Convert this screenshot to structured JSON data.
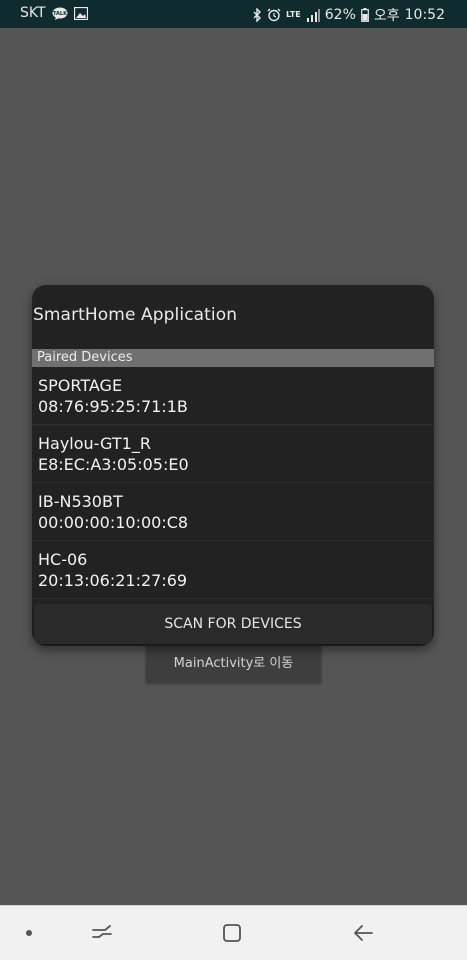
{
  "status_bar": {
    "carrier": "SKT",
    "network": "LTE",
    "battery": "62%",
    "time_period": "오후",
    "time": "10:52",
    "icons": [
      "talk-icon",
      "image-icon",
      "bluetooth-icon",
      "alarm-icon",
      "signal-icon",
      "battery-icon"
    ]
  },
  "background": {
    "main_button_label": "MainActivity로 이동"
  },
  "dialog": {
    "title": "SmartHome Application",
    "section_header": "Paired Devices",
    "devices": [
      {
        "name": "SPORTAGE",
        "address": "08:76:95:25:71:1B"
      },
      {
        "name": "Haylou-GT1_R",
        "address": "E8:EC:A3:05:05:E0"
      },
      {
        "name": "IB-N530BT",
        "address": "00:00:00:10:00:C8"
      },
      {
        "name": "HC-06",
        "address": "20:13:06:21:27:69"
      }
    ],
    "scan_button_label": "SCAN FOR DEVICES"
  },
  "nav_bar": {
    "icons": [
      "dot-icon",
      "recent-apps-icon",
      "home-icon",
      "back-icon"
    ]
  },
  "colors": {
    "status_bar_bg": "#0f2b2d",
    "dim_background": "#555555",
    "dialog_bg": "#222222",
    "section_header_bg": "#707070"
  }
}
